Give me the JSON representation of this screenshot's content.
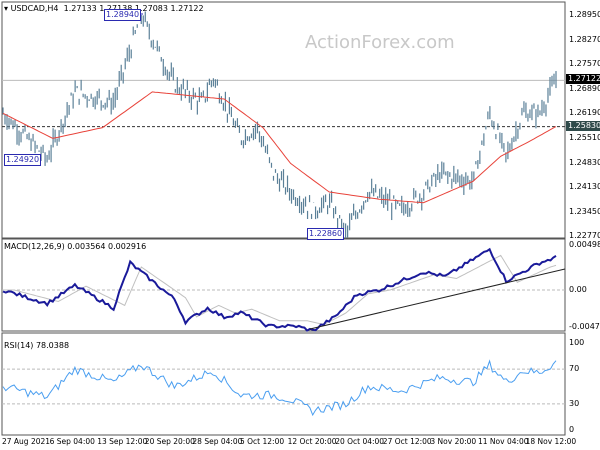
{
  "header": {
    "symbol": "USDCAD,H4",
    "ohlc": "1.27133 1.27138 1.27083 1.27122",
    "watermark": "ActionForex.com"
  },
  "price_axis": [
    "1.28950",
    "1.28270",
    "1.27570",
    "1.26890",
    "1.26190",
    "1.25510",
    "1.24830",
    "1.24130",
    "1.23450",
    "1.22770"
  ],
  "tags": {
    "last": "1.27122",
    "level": "1.25830"
  },
  "annotations": [
    "1.28940",
    "1.24920",
    "1.22860"
  ],
  "macd": {
    "label": "MACD(12,26,9) 0.003564 0.002916",
    "axis": [
      "0.00498",
      "0.00",
      "-0.004723"
    ]
  },
  "rsi": {
    "label": "RSI(14) 78.0388",
    "axis": [
      "100",
      "70",
      "30",
      "0"
    ]
  },
  "time_axis": [
    "27 Aug 2021",
    "6 Sep 04:00",
    "13 Sep 12:00",
    "20 Sep 20:00",
    "28 Sep 04:00",
    "5 Oct 12:00",
    "12 Oct 20:00",
    "20 Oct 04:00",
    "27 Oct 12:00",
    "3 Nov 20:00",
    "11 Nov 04:00",
    "18 Nov 12:00"
  ],
  "colors": {
    "bars": "#5b8098",
    "ma": "#e8433a",
    "macd": "#1a1a9a",
    "signal": "#c0c0c0",
    "rsi": "#4a9ef0"
  },
  "chart_data": {
    "type": "line",
    "title": "USDCAD,H4",
    "ylim": [
      1.2277,
      1.2895
    ],
    "price": [
      [
        0,
        1.262
      ],
      [
        8,
        1.2492
      ],
      [
        13,
        1.268
      ],
      [
        20,
        1.265
      ],
      [
        25,
        1.2894
      ],
      [
        31,
        1.27
      ],
      [
        36,
        1.265
      ],
      [
        38,
        1.272
      ],
      [
        43,
        1.255
      ],
      [
        46,
        1.258
      ],
      [
        49,
        1.245
      ],
      [
        52,
        1.24
      ],
      [
        56,
        1.235
      ],
      [
        59,
        1.237
      ],
      [
        62,
        1.2286
      ],
      [
        66,
        1.24
      ],
      [
        70,
        1.237
      ],
      [
        72,
        1.235
      ],
      [
        76,
        1.24
      ],
      [
        79,
        1.245
      ],
      [
        85,
        1.243
      ],
      [
        88,
        1.262
      ],
      [
        91,
        1.25
      ],
      [
        94,
        1.262
      ],
      [
        97,
        1.262
      ],
      [
        100,
        1.2712
      ]
    ],
    "ma": [
      [
        0,
        1.262
      ],
      [
        9,
        1.255
      ],
      [
        18,
        1.258
      ],
      [
        27,
        1.268
      ],
      [
        40,
        1.266
      ],
      [
        47,
        1.258
      ],
      [
        52,
        1.248
      ],
      [
        59,
        1.24
      ],
      [
        68,
        1.238
      ],
      [
        76,
        1.237
      ],
      [
        85,
        1.243
      ],
      [
        90,
        1.25
      ],
      [
        95,
        1.254
      ],
      [
        100,
        1.2583
      ]
    ],
    "macd": [
      [
        0,
        0.0
      ],
      [
        8,
        -0.0015
      ],
      [
        13,
        0.0005
      ],
      [
        20,
        -0.002
      ],
      [
        23,
        0.003
      ],
      [
        27,
        0.001
      ],
      [
        31,
        -0.001
      ],
      [
        33,
        -0.0035
      ],
      [
        37,
        -0.002
      ],
      [
        40,
        -0.003
      ],
      [
        43,
        -0.0025
      ],
      [
        48,
        -0.004
      ],
      [
        53,
        -0.004
      ],
      [
        56,
        -0.0045
      ],
      [
        60,
        -0.003
      ],
      [
        64,
        -0.0005
      ],
      [
        68,
        0.0
      ],
      [
        72,
        0.001
      ],
      [
        76,
        0.002
      ],
      [
        80,
        0.0015
      ],
      [
        84,
        0.003
      ],
      [
        88,
        0.0045
      ],
      [
        91,
        0.001
      ],
      [
        94,
        0.002
      ],
      [
        97,
        0.003
      ],
      [
        100,
        0.0036
      ]
    ],
    "rsi": [
      [
        0,
        50
      ],
      [
        8,
        38
      ],
      [
        13,
        70
      ],
      [
        20,
        55
      ],
      [
        25,
        75
      ],
      [
        31,
        50
      ],
      [
        38,
        68
      ],
      [
        43,
        40
      ],
      [
        49,
        40
      ],
      [
        52,
        35
      ],
      [
        56,
        22
      ],
      [
        62,
        30
      ],
      [
        66,
        50
      ],
      [
        72,
        45
      ],
      [
        79,
        60
      ],
      [
        85,
        55
      ],
      [
        88,
        75
      ],
      [
        91,
        55
      ],
      [
        94,
        68
      ],
      [
        97,
        66
      ],
      [
        100,
        78
      ]
    ]
  }
}
